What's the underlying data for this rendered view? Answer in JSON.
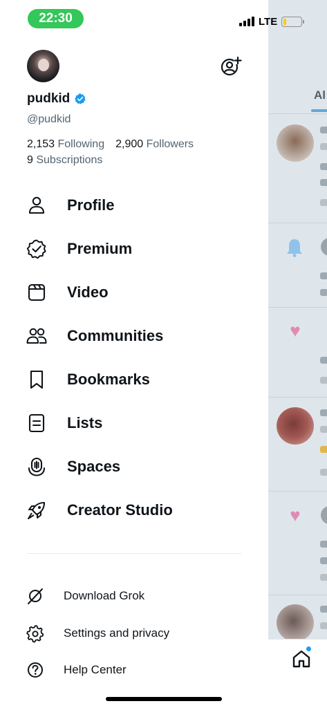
{
  "status_bar": {
    "time": "22:30",
    "network": "LTE",
    "battery_level": 0.15,
    "battery_color": "#ffcc00",
    "time_pill_color": "#34c759"
  },
  "profile": {
    "display_name": "pudkid",
    "handle": "@pudkid",
    "verified_icon": "verified-badge-icon",
    "following_count": "2,153",
    "following_label": "Following",
    "followers_count": "2,900",
    "followers_label": "Followers",
    "subscriptions_count": "9",
    "subscriptions_label": "Subscriptions"
  },
  "menu": [
    {
      "label": "Profile",
      "icon": "person-icon"
    },
    {
      "label": "Premium",
      "icon": "premium-badge-icon"
    },
    {
      "label": "Video",
      "icon": "video-icon"
    },
    {
      "label": "Communities",
      "icon": "communities-icon"
    },
    {
      "label": "Bookmarks",
      "icon": "bookmark-icon"
    },
    {
      "label": "Lists",
      "icon": "list-icon"
    },
    {
      "label": "Spaces",
      "icon": "spaces-icon"
    },
    {
      "label": "Creator Studio",
      "icon": "rocket-icon"
    }
  ],
  "secondary_menu": [
    {
      "label": "Download Grok",
      "icon": "grok-icon"
    },
    {
      "label": "Settings and privacy",
      "icon": "gear-icon"
    },
    {
      "label": "Help Center",
      "icon": "help-icon"
    }
  ],
  "timeline": {
    "tab_label": "Al",
    "accent_color": "#1d9bf0",
    "like_color": "#e08ab5"
  }
}
